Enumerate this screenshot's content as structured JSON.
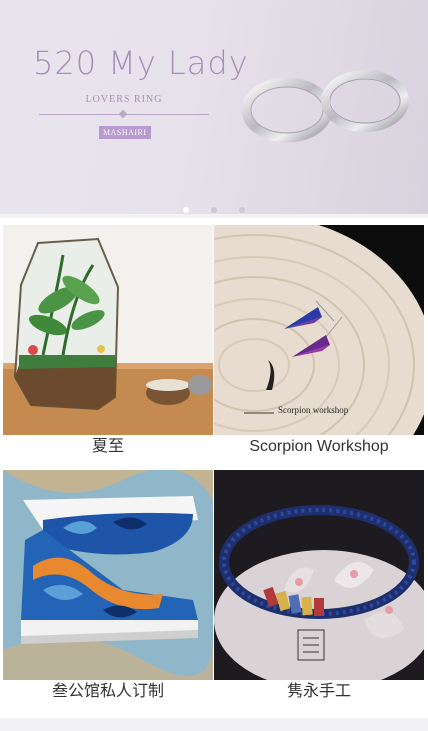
{
  "banner": {
    "title": "520  My Lady",
    "subtitle": "LOVERS RING",
    "brand": "MASHAIRI",
    "slide_count": 3,
    "active_slide": 1
  },
  "products": [
    {
      "name": "夏至"
    },
    {
      "name": "Scorpion Workshop",
      "watermark": "Scorpion workshop"
    },
    {
      "name": "叁公馆私人订制"
    },
    {
      "name": "隽永手工"
    }
  ],
  "colors": {
    "banner_accent": "#a58fb6",
    "brand_badge": "#b79ad0",
    "page_background": "#f2f1f4"
  }
}
